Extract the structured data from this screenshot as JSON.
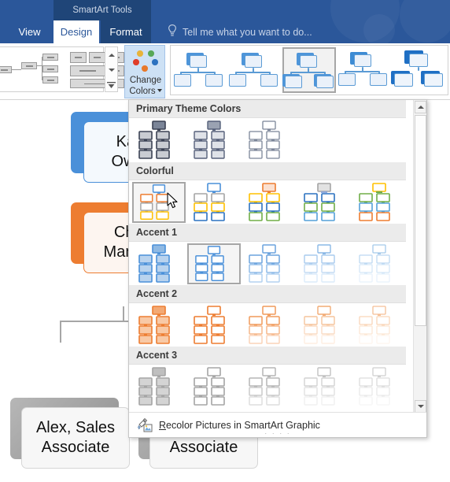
{
  "window": {
    "context_tab_title": "SmartArt Tools",
    "tabs": [
      {
        "label": "View",
        "active": false
      },
      {
        "label": "Design",
        "active": true
      },
      {
        "label": "Format",
        "active": false
      }
    ],
    "tell_me_placeholder": "Tell me what you want to do...",
    "tell_me_icon": "lightbulb-icon"
  },
  "ribbon": {
    "change_colors": {
      "label_line1": "Change",
      "label_line2": "Colors",
      "icon": "change-colors-icon",
      "dropdown_arrow": "chevron-down-icon",
      "dot_colors": [
        "#e8b33a",
        "#58a858",
        "#df3d2a",
        "#e8792a",
        "#2c72c0"
      ]
    },
    "layouts_gallery": {
      "name": "smartart-layouts-gallery",
      "scroll_up": "scroll-up-icon",
      "scroll_down": "scroll-down-icon",
      "more": "more-layouts-icon"
    },
    "styles_gallery": {
      "name": "smartart-styles-gallery",
      "selected_index": 2,
      "items": [
        {
          "name": "style-simple-fill"
        },
        {
          "name": "style-white-outline"
        },
        {
          "name": "style-subtle-effect"
        },
        {
          "name": "style-moderate-effect"
        },
        {
          "name": "style-intense-effect"
        }
      ]
    }
  },
  "dropdown": {
    "name": "change-colors-dropdown",
    "scrollbar": {
      "up_icon": "scroll-up-icon",
      "down_icon": "scroll-down-icon",
      "thumb": "scrollbar-thumb"
    },
    "sections": [
      {
        "title": "Primary Theme Colors",
        "items": [
          {
            "name": "dark-1-outline",
            "selected": false
          },
          {
            "name": "dark-2-fill",
            "selected": false
          },
          {
            "name": "dark-2-outline",
            "selected": false
          }
        ]
      },
      {
        "title": "Colorful",
        "items": [
          {
            "name": "colorful-accent-colors",
            "selected": true
          },
          {
            "name": "colorful-range-accent-colors-2-3",
            "selected": false
          },
          {
            "name": "colorful-range-accent-colors-3-4",
            "selected": false
          },
          {
            "name": "colorful-range-accent-colors-4-5",
            "selected": false
          },
          {
            "name": "colorful-range-accent-colors-5-6",
            "selected": false
          }
        ]
      },
      {
        "title": "Accent 1",
        "items": [
          {
            "name": "accent1-colored-fill",
            "selected": false
          },
          {
            "name": "accent1-colored-outline",
            "selected": true
          },
          {
            "name": "accent1-gradient-loop",
            "selected": false
          },
          {
            "name": "accent1-gradient-range",
            "selected": false
          },
          {
            "name": "accent1-transparent-gradient",
            "selected": false
          }
        ]
      },
      {
        "title": "Accent 2",
        "items": [
          {
            "name": "accent2-colored-fill",
            "selected": false
          },
          {
            "name": "accent2-colored-outline",
            "selected": false
          },
          {
            "name": "accent2-gradient-loop",
            "selected": false
          },
          {
            "name": "accent2-gradient-range",
            "selected": false
          },
          {
            "name": "accent2-transparent-gradient",
            "selected": false
          }
        ]
      },
      {
        "title": "Accent 3",
        "items": [
          {
            "name": "accent3-colored-fill",
            "selected": false
          },
          {
            "name": "accent3-colored-outline",
            "selected": false
          },
          {
            "name": "accent3-gradient-loop",
            "selected": false
          },
          {
            "name": "accent3-gradient-range",
            "selected": false
          },
          {
            "name": "accent3-transparent-gradient",
            "selected": false
          }
        ]
      }
    ],
    "footer": {
      "icon": "recolor-pictures-icon",
      "label_accesskey": "R",
      "label_rest": "ecolor Pictures in SmartArt Graphic",
      "label_full": "Recolor Pictures in SmartArt Graphic",
      "grip": "· · · ·"
    }
  },
  "smartart": {
    "name": "org-chart",
    "nodes": [
      {
        "name": "node-owner",
        "text": "Kate,\nOwner",
        "accent": "#4a90d9",
        "visible_text": "K\nOw"
      },
      {
        "name": "node-manager",
        "text": "Chris,\nManager",
        "accent": "#ed7d31",
        "visible_text": "Chri\nMan"
      },
      {
        "name": "node-alex",
        "text": "Alex, Sales\nAssociate",
        "accent": "#a6a6a6",
        "visible_text": "Alex, Sales\nAssociate"
      },
      {
        "name": "node-jerry",
        "text": "Jerry, Sales\nAssociate",
        "accent": "#a6a6a6",
        "visible_text": "Associate"
      }
    ]
  },
  "colors": {
    "ribbon_blue": "#2b579a",
    "ribbon_blue_dark": "#1f4578",
    "accent_blue": "#4a90d9",
    "accent_orange": "#ed7d31",
    "selection_gray": "#a6a6a6"
  }
}
